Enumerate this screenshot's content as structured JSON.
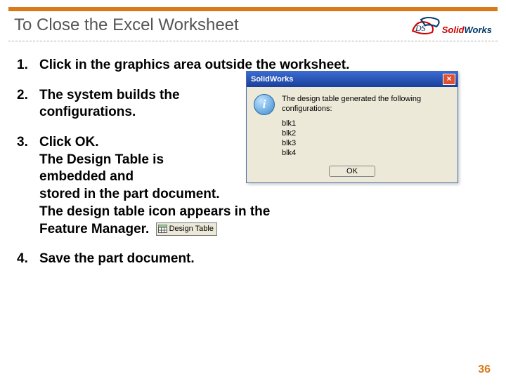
{
  "accent": "#d97a1a",
  "page_number": "36",
  "title": "To Close the Excel Worksheet",
  "logo": {
    "solid": "Solid",
    "works": "Works"
  },
  "steps": {
    "s1": "Click in the graphics area outside the worksheet.",
    "s2": "The system builds the configurations.",
    "s3": "Click OK.\nThe Design Table is embedded and stored in the part document.\nThe design table icon appears in the Feature Manager.",
    "s3_line1": "Click OK.",
    "s3_line2": "The Design Table is",
    "s3_line3": "embedded and",
    "s3_line4": "stored in the part document.",
    "s3_line5": "The design table icon appears in the",
    "s3_line6": "Feature Manager.",
    "s4": "Save the part document."
  },
  "dialog": {
    "title": "SolidWorks",
    "message": "The design table generated the following configurations:",
    "items": [
      "blk1",
      "blk2",
      "blk3",
      "blk4"
    ],
    "ok": "OK"
  },
  "design_table_label": "Design Table"
}
